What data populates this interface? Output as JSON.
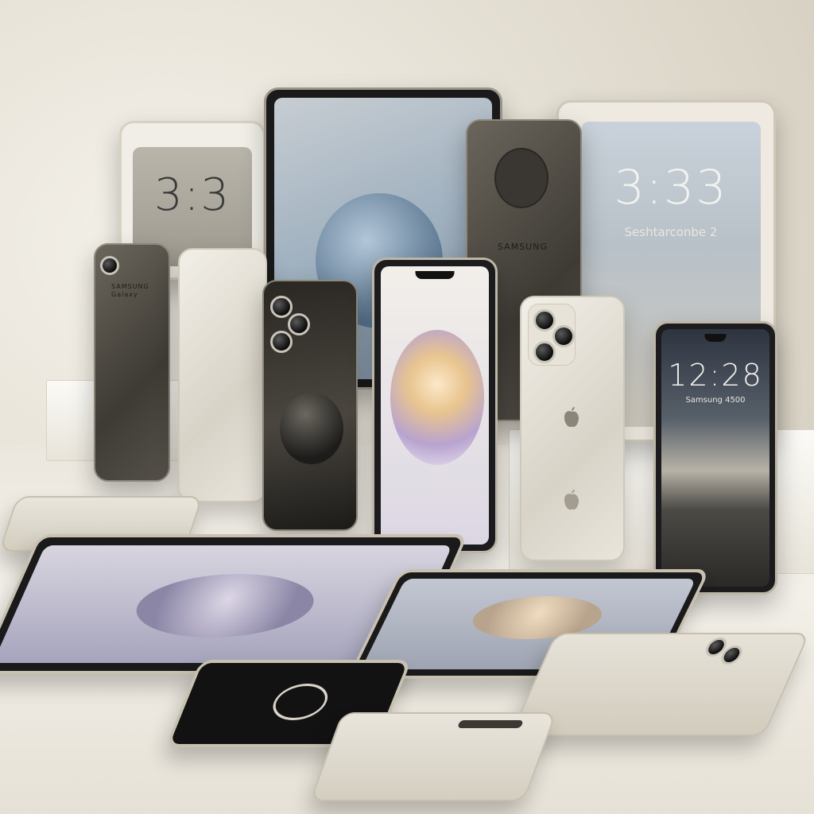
{
  "scene": {
    "tablet_left_back": {
      "clock": "3:3"
    },
    "tablet_right_back": {
      "clock": "3:33",
      "subtitle": "Seshtarconbe 2"
    },
    "phone_dark_back_brand": "SAMSUNG",
    "phone_small_brand": "SAMSUNG Galaxy",
    "phone_lockscreen": {
      "clock": "12:28",
      "subtitle": "Samsung 4500"
    }
  }
}
